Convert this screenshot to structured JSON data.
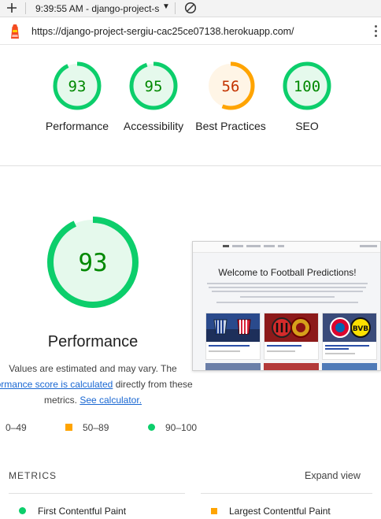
{
  "toolbar": {
    "time_title": "9:39:55 AM - django-project-s"
  },
  "urlbar": {
    "url": "https://django-project-sergiu-cac25ce07138.herokuapp.com/"
  },
  "scores": [
    {
      "label": "Performance",
      "value": "93",
      "fraction": 0.93,
      "status": "pass"
    },
    {
      "label": "Accessibility",
      "value": "95",
      "fraction": 0.95,
      "status": "pass"
    },
    {
      "label": "Best Practices",
      "value": "56",
      "fraction": 0.56,
      "status": "average"
    },
    {
      "label": "SEO",
      "value": "100",
      "fraction": 1.0,
      "status": "pass"
    }
  ],
  "main": {
    "score": "93",
    "fraction": 0.93,
    "title": "Performance",
    "desc_1": "Values are estimated and may vary. The",
    "desc_link": "formance score is calculated",
    "desc_2": "directly from these",
    "desc_3": "metrics.",
    "calc_link": "See calculator."
  },
  "legend": {
    "fail": "0–49",
    "average": "50–89",
    "pass": "90–100"
  },
  "thumbnail": {
    "title": "Welcome to Football Predictions!"
  },
  "metrics": {
    "heading": "METRICS",
    "expand": "Expand view",
    "items": [
      {
        "label": "First Contentful Paint",
        "status": "pass"
      },
      {
        "label": "Largest Contentful Paint",
        "status": "average"
      }
    ]
  },
  "colors": {
    "pass": "#0cce6b",
    "pass_text": "#008800",
    "pass_bg": "#e5f9ec",
    "average": "#ffa400",
    "average_text": "#c33300",
    "average_bg": "#fff5e6",
    "fail": "#ff4e42",
    "link": "#1967d2"
  }
}
